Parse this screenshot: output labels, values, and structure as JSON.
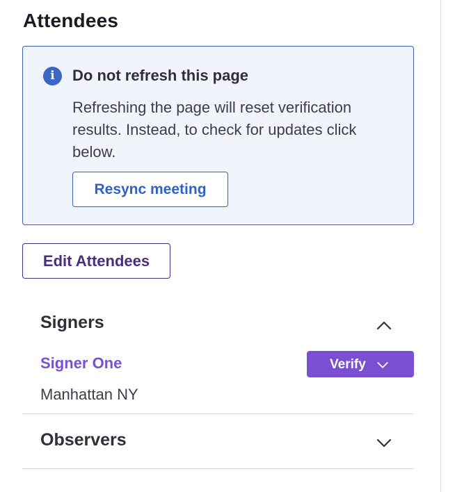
{
  "page": {
    "title": "Attendees"
  },
  "alert": {
    "icon": "info-icon",
    "icon_glyph": "i",
    "heading": "Do not refresh this page",
    "body": "Refreshing the page will reset verification results. Instead, to check for updates click below.",
    "button_label": "Resync meeting",
    "colors": {
      "background": "#f1f5fb",
      "border": "#3b5fb0",
      "icon": "#3c67c5"
    }
  },
  "edit_button": {
    "label": "Edit Attendees",
    "color": "#4a2e7c"
  },
  "sections": {
    "signers": {
      "label": "Signers",
      "expanded": true,
      "toggle_icon": "chevron-up-icon",
      "items": [
        {
          "name": "Signer One",
          "location": "Manhattan NY",
          "action_label": "Verify",
          "action_icon": "chevron-down-icon"
        }
      ]
    },
    "observers": {
      "label": "Observers",
      "expanded": false,
      "toggle_icon": "chevron-down-icon"
    }
  },
  "colors": {
    "accent_purple": "#7a4fd2",
    "text_dark": "#2f2f3a",
    "link_blue": "#2f62c3"
  }
}
